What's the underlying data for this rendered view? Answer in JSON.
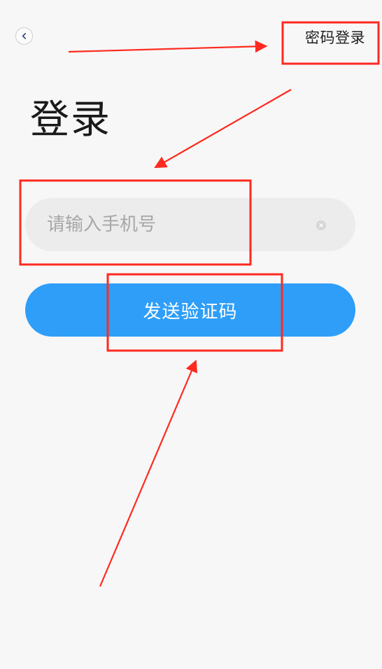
{
  "header": {
    "back_icon": "chevron-left-icon",
    "password_login_label": "密码登录"
  },
  "main": {
    "title": "登录",
    "phone_input": {
      "value": "",
      "placeholder": "请输入手机号",
      "clear_icon": "clear-x-icon"
    },
    "send_code_label": "发送验证码"
  },
  "colors": {
    "background": "#f7f7f7",
    "primary": "#2e9ef9",
    "input_bg": "#ececec",
    "annotation": "#ff2a1f"
  }
}
